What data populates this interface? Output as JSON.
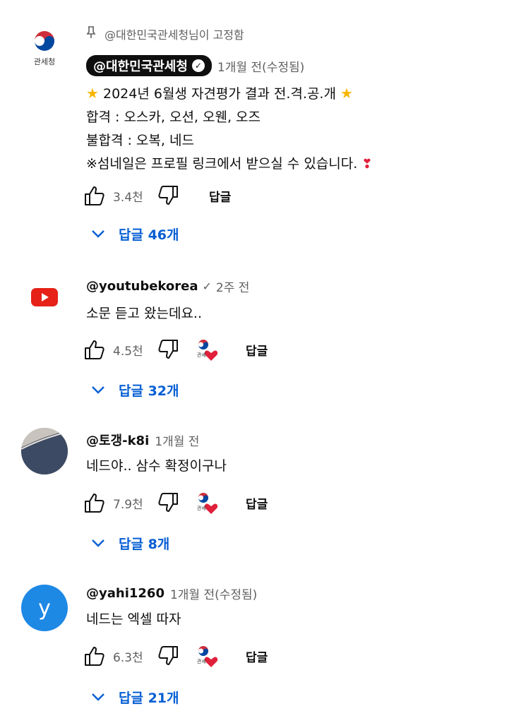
{
  "colors": {
    "link_blue": "#065fd4",
    "meta_grey": "#606060",
    "youtube_red": "#e62117",
    "heart_red": "#e0203a",
    "avatar_y_blue": "#1e88e5"
  },
  "comments": [
    {
      "pinned_label": "@대한민국관세청님이 고정함",
      "avatar_label": "관세청",
      "author": "@대한민국관세청",
      "verified_owner": true,
      "time": "1개월 전(수정됨)",
      "lines": [
        "2024년 6월생 자견평가 결과 전.격.공.개",
        "합격 : 오스카, 오션, 오웬, 오즈",
        "불합격 : 오복, 네드",
        "※섬네일은 프로필 링크에서 받으실 수 있습니다."
      ],
      "likes": "3.4천",
      "reply_label": "답글",
      "replies_label": "답글 46개",
      "hearted": false
    },
    {
      "author": "@youtubekorea",
      "time": "2주 전",
      "lines": [
        "소문 듣고 왔는데요.."
      ],
      "likes": "4.5천",
      "reply_label": "답글",
      "replies_label": "답글 32개",
      "hearted": true,
      "heart_badge_text": "관세"
    },
    {
      "author": "@토갱-k8i",
      "time": "1개월 전",
      "lines": [
        "네드야.. 삼수 확정이구나"
      ],
      "likes": "7.9천",
      "reply_label": "답글",
      "replies_label": "답글 8개",
      "hearted": true,
      "heart_badge_text": "관세"
    },
    {
      "avatar_letter": "y",
      "author": "@yahi1260",
      "time": "1개월 전(수정됨)",
      "lines": [
        "네드는 엑셀 따자"
      ],
      "likes": "6.3천",
      "reply_label": "답글",
      "replies_label": "답글 21개",
      "hearted": true,
      "heart_badge_text": "관세"
    }
  ]
}
